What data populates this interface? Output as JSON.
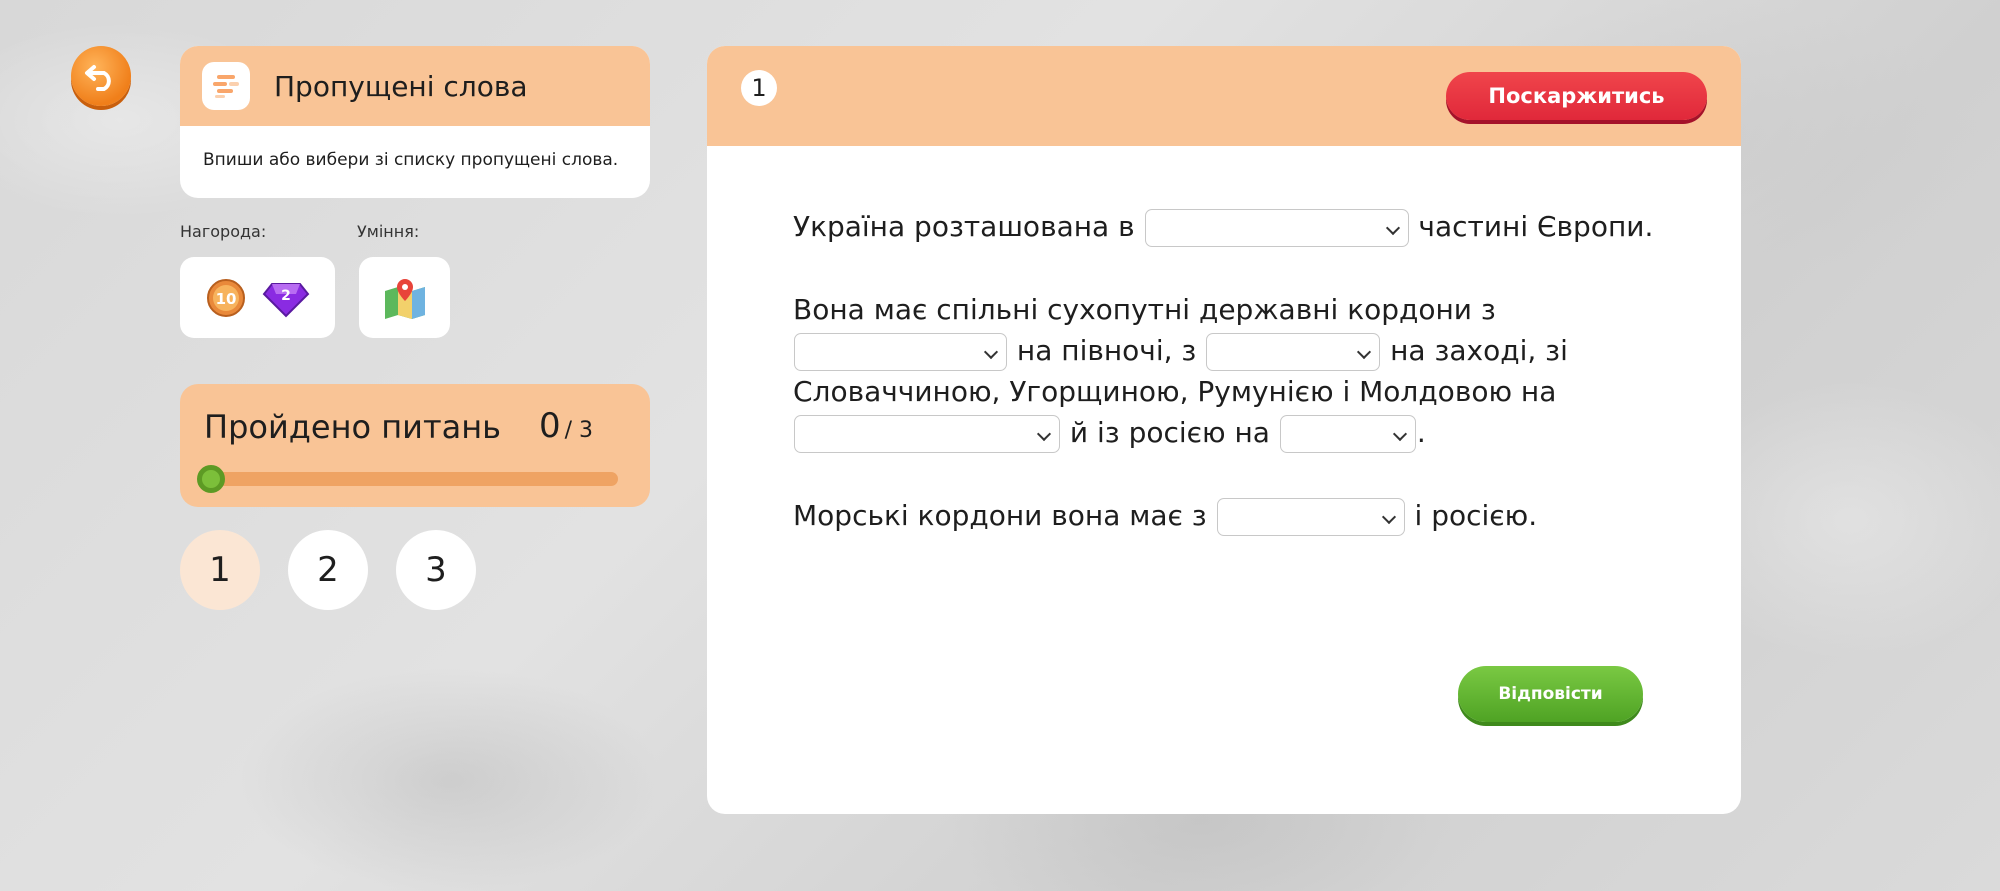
{
  "task": {
    "title": "Пропущені слова",
    "description": "Впиши або вибери зі списку пропущені слова."
  },
  "reward": {
    "label": "Нагорода:",
    "coins": "10",
    "gems": "2"
  },
  "skills": {
    "label": "Уміння:"
  },
  "progress": {
    "label": "Пройдено питань",
    "done": "0",
    "total": "/ 3",
    "fraction": 0
  },
  "question_nav": [
    "1",
    "2",
    "3"
  ],
  "question": {
    "number": "1",
    "complain_label": "Поскаржитись",
    "answer_label": "Відповісти",
    "p1": {
      "t1": "Україна розташована в",
      "t2": "частині Європи."
    },
    "p2": {
      "t1": "Вона має спільні сухопутні державні кордони з",
      "t2": "на півночі, з",
      "t3": "на заході, зі Словаччиною, Угорщиною, Румунією і Молдовою на",
      "t4": "й із росією на",
      "t5": "."
    },
    "p3": {
      "t1": "Морські кордони вона має з",
      "t2": "і росією."
    }
  },
  "colors": {
    "header": "#f9c496",
    "accent_red": "#e0283a",
    "accent_green": "#4fa324",
    "back": "#f07f1a"
  }
}
